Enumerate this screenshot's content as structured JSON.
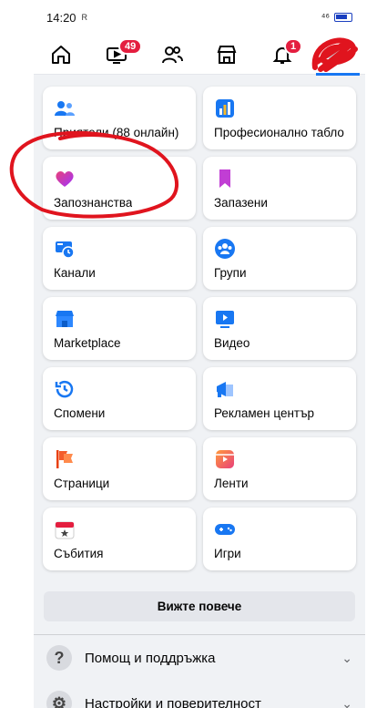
{
  "status": {
    "time": "14:20",
    "icons_left": "R",
    "icons_right": "⁴⁶"
  },
  "nav": {
    "video_badge": "49",
    "notif_badge": "1"
  },
  "tiles": [
    {
      "label": "Приятели (88 онлайн)",
      "icon": "friends-icon"
    },
    {
      "label": "Професионално табло",
      "icon": "dashboard-icon"
    },
    {
      "label": "Запознанства",
      "icon": "dating-heart-icon"
    },
    {
      "label": "Запазени",
      "icon": "bookmark-icon"
    },
    {
      "label": "Канали",
      "icon": "feeds-icon"
    },
    {
      "label": "Групи",
      "icon": "groups-icon"
    },
    {
      "label": "Marketplace",
      "icon": "marketplace-icon"
    },
    {
      "label": "Видео",
      "icon": "video-icon"
    },
    {
      "label": "Спомени",
      "icon": "memories-icon"
    },
    {
      "label": "Рекламен център",
      "icon": "ad-center-icon"
    },
    {
      "label": "Страници",
      "icon": "pages-flag-icon"
    },
    {
      "label": "Ленти",
      "icon": "reels-icon"
    },
    {
      "label": "Събития",
      "icon": "events-icon"
    },
    {
      "label": "Игри",
      "icon": "gaming-icon"
    }
  ],
  "see_more": "Вижте повече",
  "sections": [
    {
      "label": "Помощ и поддръжка",
      "icon": "help-icon"
    },
    {
      "label": "Настройки и поверителност",
      "icon": "settings-icon"
    }
  ],
  "colors": {
    "accent": "#1877f2",
    "badge": "#e41e3f",
    "annotation": "#e0141e"
  }
}
